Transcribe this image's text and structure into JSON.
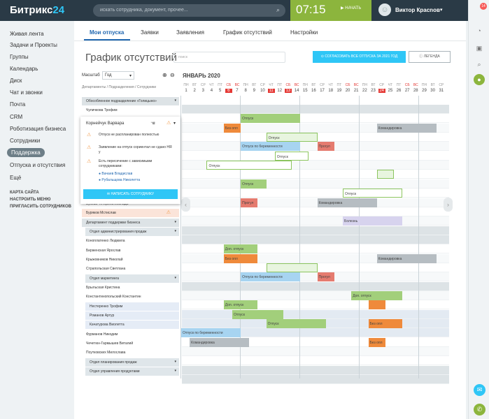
{
  "header": {
    "logo_text": "Битрикс",
    "logo_num": "24",
    "search_placeholder": "искать сотрудника, документ, прочее...",
    "time": "07:15",
    "time_button": "НАЧАТЬ",
    "user_name": "Виктор Красnoв",
    "notif_count": "14"
  },
  "sidebar": {
    "items": [
      "Живая лента",
      "Задачи и Проекты",
      "Группы",
      "Календарь",
      "Диск",
      "Чат и звонки",
      "Почта",
      "CRM",
      "Роботизация бизнеса",
      "Сотрудники",
      "Поддержка",
      "Отпуска и отсутствия",
      "Ещё"
    ],
    "selected_index": 10,
    "extra": [
      "КАРТА САЙТА",
      "НАСТРОИТЬ МЕНЮ",
      "ПРИГЛАСИТЬ СОТРУДНИКОВ"
    ]
  },
  "tabs": [
    "Мои отпуска",
    "Заявки",
    "Заявления",
    "График отсутствий",
    "Настройки"
  ],
  "page": {
    "title": "График отсутствий",
    "search_placeholder": "поиск",
    "agree_button": "СОГЛАСОВАТЬ ВСЕ ОТПУСКА ЗА 2021 ГОД",
    "legend_button": "ЛЕГЕНДА",
    "scale_label": "Масштаб",
    "scale_value": "Год",
    "breadcrumb": "Департаменты / Подразделения / Сотрудники",
    "month": "ЯНВАРЬ 2020"
  },
  "calendar": {
    "weekdays": [
      "ПН",
      "ВТ",
      "СР",
      "ЧТ",
      "ПТ",
      "СБ",
      "ВС",
      "ПН",
      "ВТ",
      "СР",
      "ЧТ",
      "ПТ",
      "СБ",
      "ВС",
      "ПН",
      "ВТ",
      "СР",
      "ЧТ",
      "ПТ",
      "СБ",
      "ВС",
      "ПН",
      "ВТ",
      "СР",
      "ЧТ",
      "ПТ",
      "СБ",
      "ВС",
      "ПН",
      "ВТ",
      "СР"
    ],
    "days": [
      "1",
      "2",
      "3",
      "4",
      "5",
      "6",
      "7",
      "8",
      "9",
      "10",
      "11",
      "12",
      "13",
      "14",
      "15",
      "16",
      "17",
      "18",
      "19",
      "20",
      "21",
      "22",
      "23",
      "24",
      "25",
      "26",
      "27",
      "28",
      "29",
      "30",
      "31"
    ],
    "red_days": [
      5,
      10,
      12,
      23
    ]
  },
  "rows": [
    {
      "label": "Обособленное подразделение «Голицыно»",
      "type": "grp"
    },
    {
      "label": "Чуличкова Трофим",
      "type": "emp"
    },
    {
      "label": "Корнейчук Варвара",
      "type": "emp"
    },
    {
      "label": "",
      "type": "emp"
    },
    {
      "label": "",
      "type": "emp"
    },
    {
      "label": "",
      "type": "emp"
    },
    {
      "label": "",
      "type": "emp"
    },
    {
      "label": "",
      "type": "emp"
    },
    {
      "label": "",
      "type": "emp"
    },
    {
      "label": "",
      "type": "emp"
    },
    {
      "label": "Чуличков Трофим",
      "type": "emp"
    },
    {
      "label": "Букова-Тетерина Изольда",
      "type": "emp"
    },
    {
      "label": "Буряков Мстислав",
      "type": "peach"
    },
    {
      "label": "Департамент поддержки бизнеса",
      "type": "grp"
    },
    {
      "label": "Отдел администрирования продаж",
      "type": "sub"
    },
    {
      "label": "Коноплатенко Людмила",
      "type": "emp"
    },
    {
      "label": "Бирженская Ярослав",
      "type": "emp"
    },
    {
      "label": "Крыжовников Николай",
      "type": "emp"
    },
    {
      "label": "Страпольская Светлана",
      "type": "emp"
    },
    {
      "label": "Отдел маркетинга",
      "type": "sub"
    },
    {
      "label": "Брыльская Кристина",
      "type": "emp"
    },
    {
      "label": "Константинопольский Константин",
      "type": "emp"
    },
    {
      "label": "Нестеренко Трофим",
      "type": "lblue"
    },
    {
      "label": "Романов Артур",
      "type": "lblue"
    },
    {
      "label": "Качатурова Виолетта",
      "type": "lblue"
    },
    {
      "label": "Фурманов Никодим",
      "type": "emp"
    },
    {
      "label": "Чечетюн-Гармышев Виталий",
      "type": "emp"
    },
    {
      "label": "Поутковских Милослава",
      "type": "emp"
    },
    {
      "label": "Отдел планирования продаж",
      "type": "sub"
    },
    {
      "label": "Отдел управления продуктами",
      "type": "sub"
    }
  ],
  "bars": [
    {
      "row": 1,
      "start": 7,
      "end": 14,
      "text": "Отпуск",
      "color": "#a2cf7b"
    },
    {
      "row": 2,
      "start": 5,
      "end": 7,
      "text": "Без опл",
      "color": "#ef8a3b"
    },
    {
      "row": 2,
      "start": 23,
      "end": 30,
      "text": "Командировка",
      "color": "#b6bdc2"
    },
    {
      "row": 3,
      "start": 10,
      "end": 16,
      "text": "Отпуск",
      "color": "#e8f5df"
    },
    {
      "row": 4,
      "start": 7,
      "end": 14,
      "text": "Отпуск по беременности",
      "color": "#a7d4f1"
    },
    {
      "row": 4,
      "start": 16,
      "end": 18,
      "text": "Прогул",
      "color": "#e57b6f"
    },
    {
      "row": 5,
      "start": 11,
      "end": 15,
      "text": "Отпуск",
      "color": "#fff"
    },
    {
      "row": 6,
      "start": 3,
      "end": 13,
      "text": "Отпуск",
      "color": "#fff"
    },
    {
      "row": 7,
      "start": 23,
      "end": 25,
      "text": "",
      "color": "#e8f5df"
    },
    {
      "row": 8,
      "start": 7,
      "end": 10,
      "text": "Отпуск",
      "color": "#a2cf7b"
    },
    {
      "row": 9,
      "start": 19,
      "end": 26,
      "text": "Отпуск",
      "color": "#fff"
    },
    {
      "row": 10,
      "start": 7,
      "end": 9,
      "text": "Прогул",
      "color": "#e57b6f"
    },
    {
      "row": 10,
      "start": 16,
      "end": 23,
      "text": "Командировка",
      "color": "#b6bdc2"
    },
    {
      "row": 12,
      "start": 19,
      "end": 26,
      "text": "Болезнь",
      "color": "#d7d3ee"
    },
    {
      "row": 15,
      "start": 5,
      "end": 9,
      "text": "Доп. отпуск",
      "color": "#a2cf7b"
    },
    {
      "row": 16,
      "start": 5,
      "end": 9,
      "text": "Без опл",
      "color": "#ef8a3b"
    },
    {
      "row": 16,
      "start": 23,
      "end": 30,
      "text": "Командировка",
      "color": "#b6bdc2"
    },
    {
      "row": 17,
      "start": 10,
      "end": 16,
      "text": "",
      "color": "#e8f5df"
    },
    {
      "row": 18,
      "start": 7,
      "end": 14,
      "text": "Отпуск по беременности",
      "color": "#a7d4f1"
    },
    {
      "row": 18,
      "start": 16,
      "end": 18,
      "text": "Прогул",
      "color": "#e57b6f"
    },
    {
      "row": 20,
      "start": 20,
      "end": 26,
      "text": "Доп. отпуск",
      "color": "#a2cf7b"
    },
    {
      "row": 21,
      "start": 5,
      "end": 9,
      "text": "Доп. отпуск",
      "color": "#a2cf7b"
    },
    {
      "row": 21,
      "start": 22,
      "end": 24,
      "text": "",
      "color": "#ef8a3b"
    },
    {
      "row": 22,
      "start": 6,
      "end": 12,
      "text": "Отпуск",
      "color": "#a2cf7b"
    },
    {
      "row": 23,
      "start": 10,
      "end": 17,
      "text": "Отпуск",
      "color": "#a2cf7b"
    },
    {
      "row": 23,
      "start": 22,
      "end": 26,
      "text": "Без опл",
      "color": "#ef8a3b"
    },
    {
      "row": 24,
      "start": 0,
      "end": 7,
      "text": "Отпуск по беременности",
      "color": "#a7d4f1"
    },
    {
      "row": 25,
      "start": 1,
      "end": 8,
      "text": "Командировка",
      "color": "#b6bdc2"
    },
    {
      "row": 25,
      "start": 22,
      "end": 24,
      "text": "Без опл",
      "color": "#ef8a3b"
    }
  ],
  "popup": {
    "name": "Корнейчук Варвара",
    "warnings": [
      "Отпуск не распланирован полностью",
      "Заявление на отпуск сориентал не сдано НЯ у",
      "Есть пересечение с зависимыми сотрудниками:"
    ],
    "people": [
      "Вачаев Владислав",
      "Рубальщова Николетта"
    ],
    "button": "НАПИСАТЬ СОТРУДНИКУ"
  }
}
